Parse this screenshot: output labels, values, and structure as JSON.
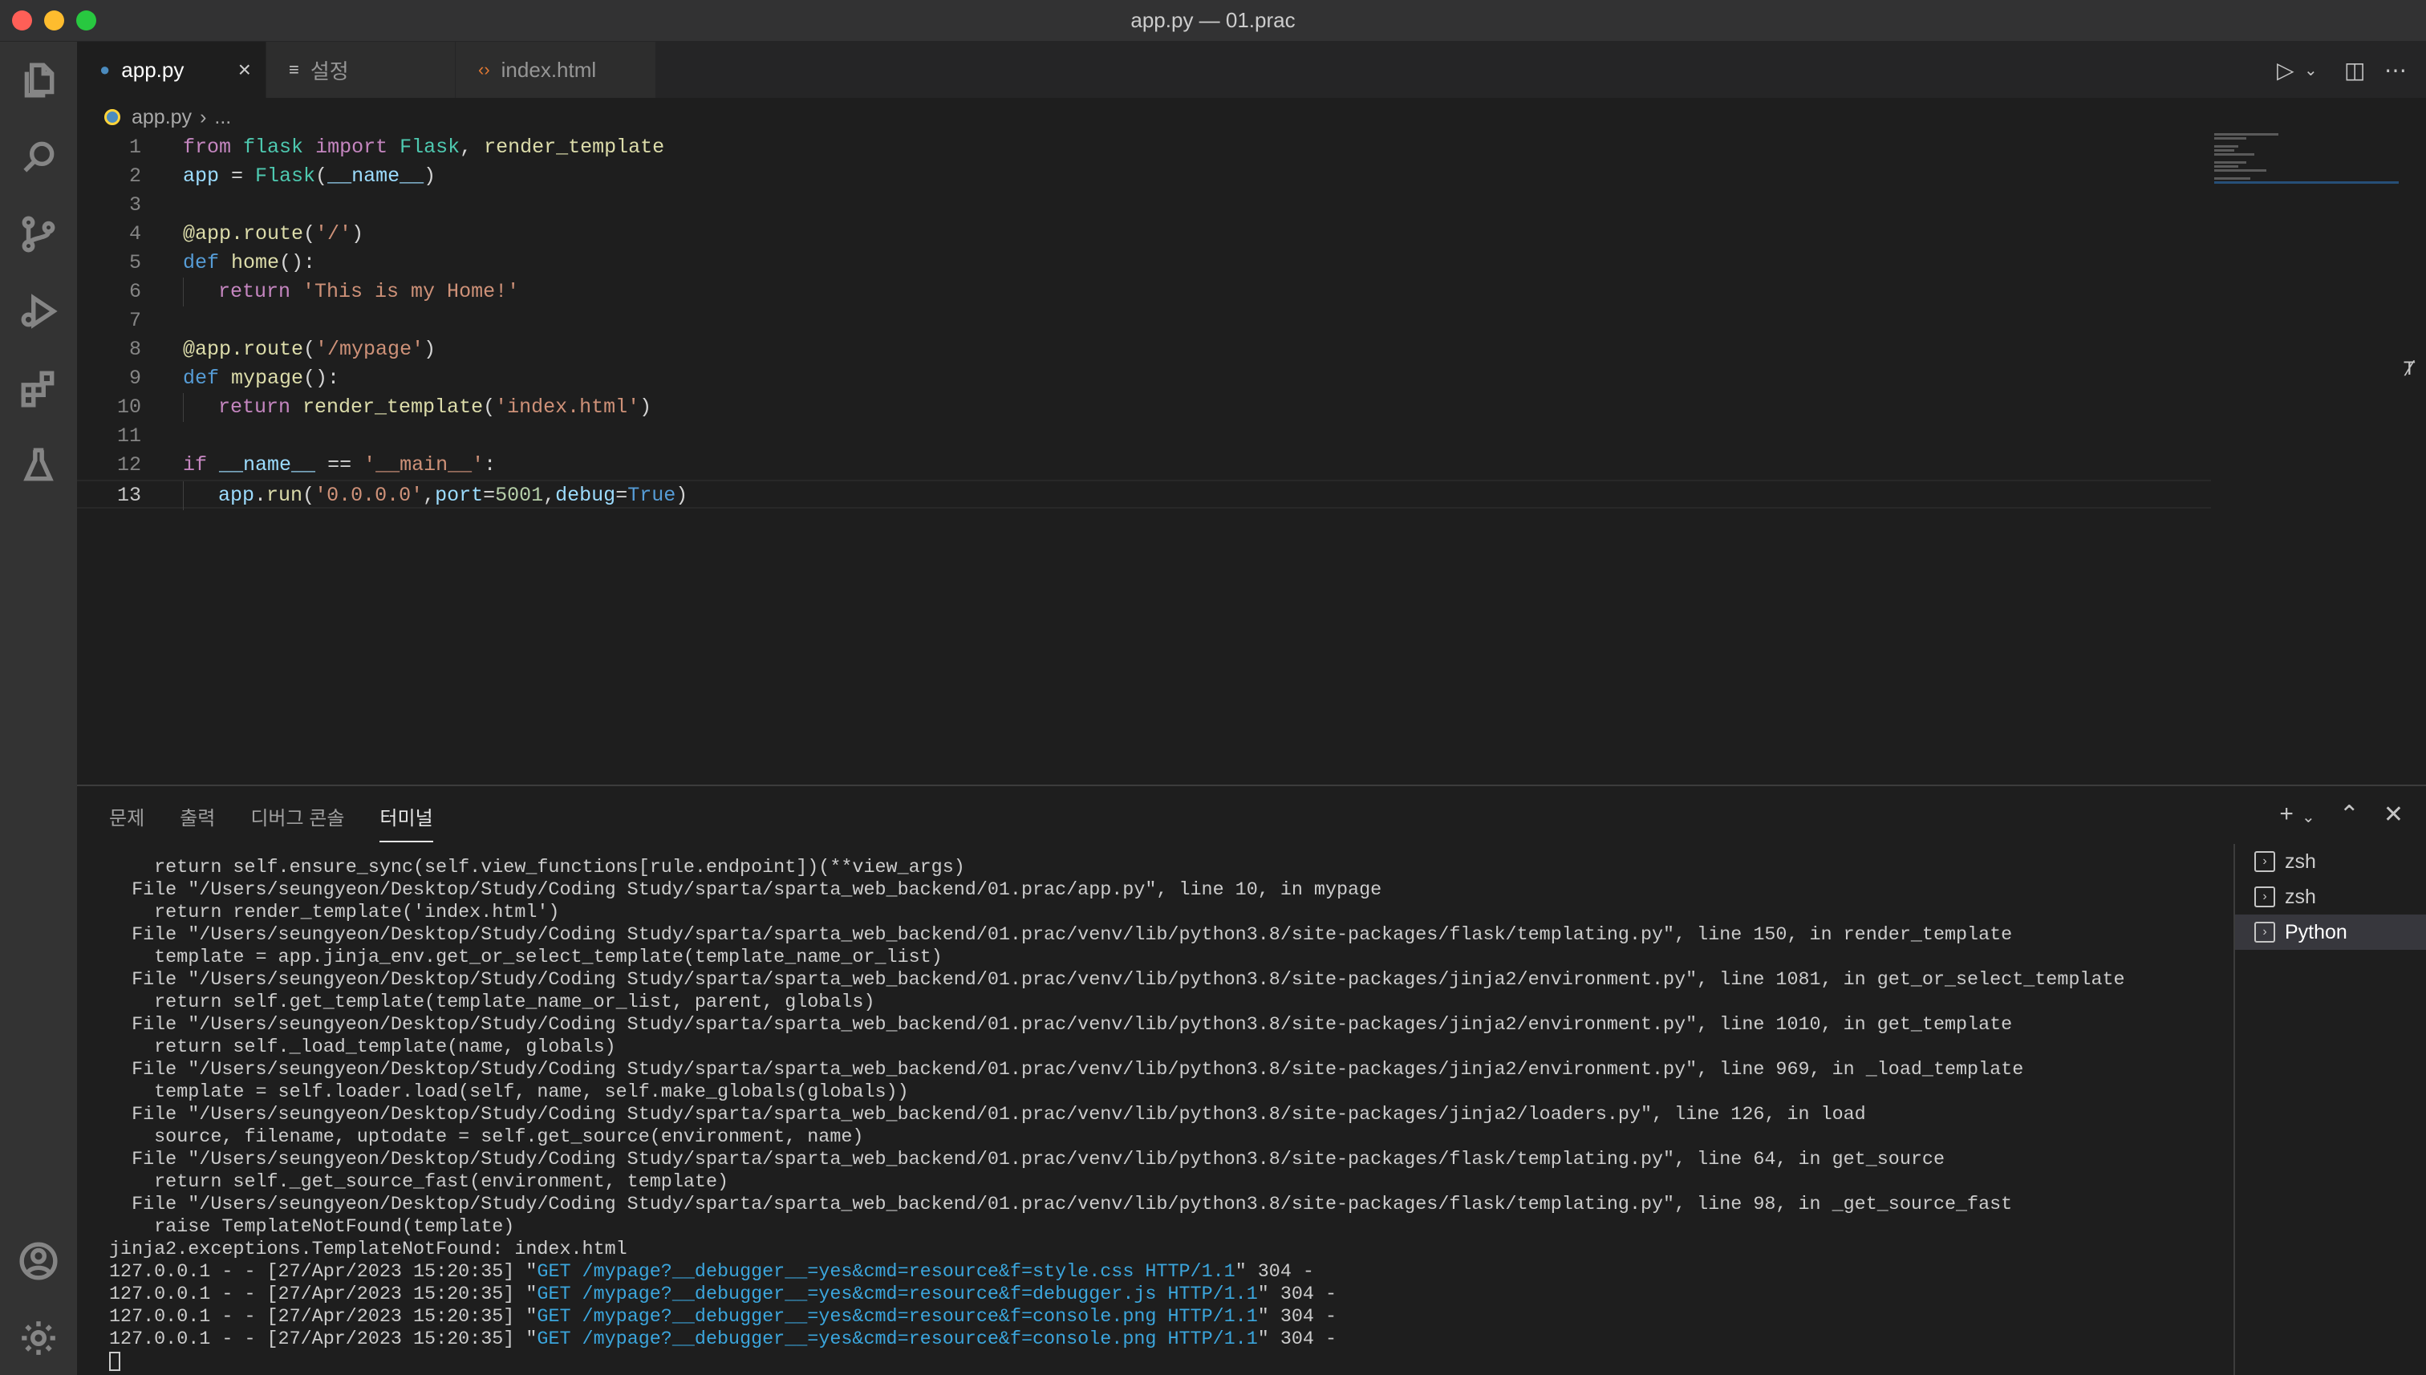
{
  "window": {
    "title": "app.py — 01.prac"
  },
  "tabs": [
    {
      "label": "app.py",
      "icon": "python-file-icon"
    },
    {
      "label": "설정",
      "icon": "settings-file-icon"
    },
    {
      "label": "index.html",
      "icon": "html-file-icon"
    }
  ],
  "breadcrumb": {
    "file": "app.py",
    "rest": "..."
  },
  "editor": {
    "line_numbers": [
      "1",
      "2",
      "3",
      "4",
      "5",
      "6",
      "7",
      "8",
      "9",
      "10",
      "11",
      "12",
      "13"
    ]
  },
  "panel": {
    "tabs": [
      "문제",
      "출력",
      "디버그 콘솔",
      "터미널"
    ],
    "terminal_lines": [
      "    return self.ensure_sync(self.view_functions[rule.endpoint])(**view_args)",
      "  File \"/Users/seungyeon/Desktop/Study/Coding Study/sparta/sparta_web_backend/01.prac/app.py\", line 10, in mypage",
      "    return render_template('index.html')",
      "  File \"/Users/seungyeon/Desktop/Study/Coding Study/sparta/sparta_web_backend/01.prac/venv/lib/python3.8/site-packages/flask/templating.py\", line 150, in render_template",
      "    template = app.jinja_env.get_or_select_template(template_name_or_list)",
      "  File \"/Users/seungyeon/Desktop/Study/Coding Study/sparta/sparta_web_backend/01.prac/venv/lib/python3.8/site-packages/jinja2/environment.py\", line 1081, in get_or_select_template",
      "    return self.get_template(template_name_or_list, parent, globals)",
      "  File \"/Users/seungyeon/Desktop/Study/Coding Study/sparta/sparta_web_backend/01.prac/venv/lib/python3.8/site-packages/jinja2/environment.py\", line 1010, in get_template",
      "    return self._load_template(name, globals)",
      "  File \"/Users/seungyeon/Desktop/Study/Coding Study/sparta/sparta_web_backend/01.prac/venv/lib/python3.8/site-packages/jinja2/environment.py\", line 969, in _load_template",
      "    template = self.loader.load(self, name, self.make_globals(globals))",
      "  File \"/Users/seungyeon/Desktop/Study/Coding Study/sparta/sparta_web_backend/01.prac/venv/lib/python3.8/site-packages/jinja2/loaders.py\", line 126, in load",
      "    source, filename, uptodate = self.get_source(environment, name)",
      "  File \"/Users/seungyeon/Desktop/Study/Coding Study/sparta/sparta_web_backend/01.prac/venv/lib/python3.8/site-packages/flask/templating.py\", line 64, in get_source",
      "    return self._get_source_fast(environment, template)",
      "  File \"/Users/seungyeon/Desktop/Study/Coding Study/sparta/sparta_web_backend/01.prac/venv/lib/python3.8/site-packages/flask/templating.py\", line 98, in _get_source_fast",
      "    raise TemplateNotFound(template)",
      "jinja2.exceptions.TemplateNotFound: index.html"
    ],
    "requests": [
      {
        "prefix": "127.0.0.1 - - [27/Apr/2023 15:20:35] \"",
        "request": "GET /mypage?__debugger__=yes&cmd=resource&f=style.css HTTP/1.1",
        "suffix": "\" 304 -"
      },
      {
        "prefix": "127.0.0.1 - - [27/Apr/2023 15:20:35] \"",
        "request": "GET /mypage?__debugger__=yes&cmd=resource&f=debugger.js HTTP/1.1",
        "suffix": "\" 304 -"
      },
      {
        "prefix": "127.0.0.1 - - [27/Apr/2023 15:20:35] \"",
        "request": "GET /mypage?__debugger__=yes&cmd=resource&f=console.png HTTP/1.1",
        "suffix": "\" 304 -"
      },
      {
        "prefix": "127.0.0.1 - - [27/Apr/2023 15:20:35] \"",
        "request": "GET /mypage?__debugger__=yes&cmd=resource&f=console.png HTTP/1.1",
        "suffix": "\" 304 -"
      }
    ],
    "terminals": [
      "zsh",
      "zsh",
      "Python"
    ],
    "selected_terminal": "Python"
  },
  "colors": {
    "accent": "#3ba6dd",
    "editor_bg": "#1e1e1e",
    "activitybar_bg": "#333333"
  }
}
